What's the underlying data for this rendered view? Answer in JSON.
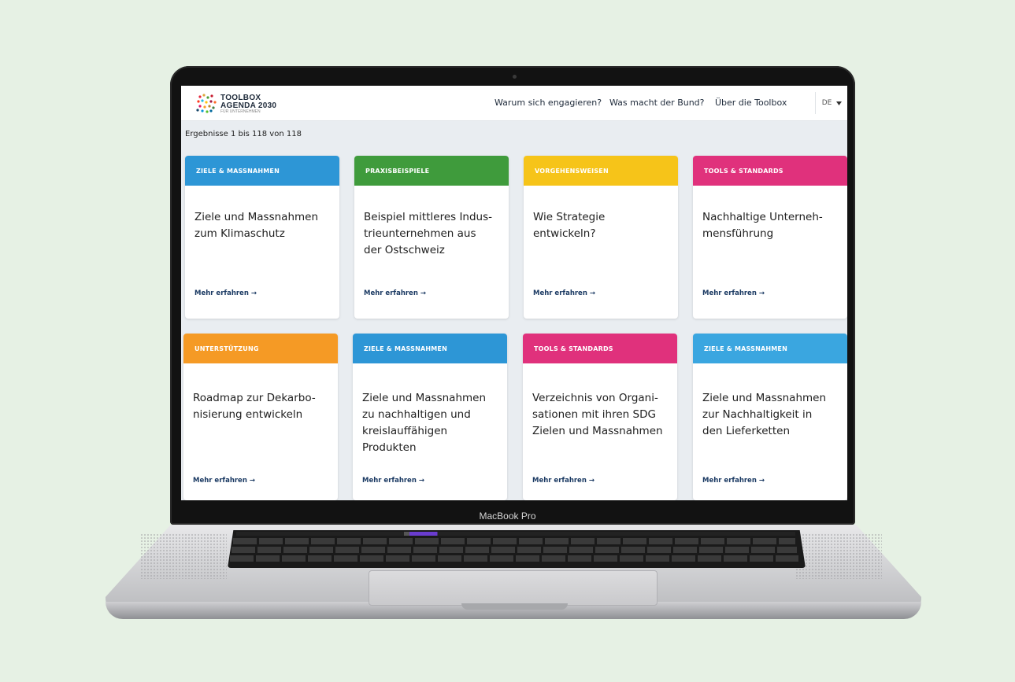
{
  "device": {
    "brand_label": "MacBook Pro"
  },
  "site": {
    "logo": {
      "line1": "TOOLBOX",
      "line2": "AGENDA 2030",
      "line3": "FÜR UNTERNEHMEN"
    },
    "nav": [
      {
        "label": "Warum sich engagieren?"
      },
      {
        "label": "Was macht der Bund?"
      },
      {
        "label": "Über die Toolbox"
      }
    ],
    "language": {
      "selected": "DE",
      "icon": "caret-down-icon"
    }
  },
  "results": {
    "text": "Ergebnisse 1 bis 118 von 118"
  },
  "cards": [
    {
      "category": "ZIELE & MASSNAHMEN",
      "color": "#2d96d6",
      "title": "Ziele und Massnahmen\nzum Klimaschutz",
      "link": "Mehr erfahren →"
    },
    {
      "category": "PRAXISBEISPIELE",
      "color": "#3f9b3c",
      "title": "Beispiel mittleres Indus-\ntrieunternehmen aus\nder Ostschweiz",
      "link": "Mehr erfahren →"
    },
    {
      "category": "VORGEHENSWEISEN",
      "color": "#f6c419",
      "title": "Wie Strategie\nentwickeln?",
      "link": "Mehr erfahren →"
    },
    {
      "category": "TOOLS & STANDARDS",
      "color": "#e0317c",
      "title": "Nachhaltige Unterneh-\nmensführung",
      "link": "Mehr erfahren →"
    },
    {
      "category": "UNTERSTÜTZUNG",
      "color": "#f59a25",
      "title": "Roadmap zur Dekarbo-\nnisierung entwickeln",
      "link": "Mehr erfahren →"
    },
    {
      "category": "ZIELE & MASSNAHMEN",
      "color": "#2d96d6",
      "title": "Ziele und Massnahmen\nzu nachhaltigen und\nkreislauffähigen\nProdukten",
      "link": "Mehr erfahren →"
    },
    {
      "category": "TOOLS & STANDARDS",
      "color": "#e0317c",
      "title": "Verzeichnis von Organi-\nsationen mit ihren SDG\nZielen und Massnahmen",
      "link": "Mehr erfahren →"
    },
    {
      "category": "ZIELE & MASSNAHMEN",
      "color": "#3aa6e0",
      "title": "Ziele und Massnahmen\nzur Nachhaltigkeit in\nden Lieferketten",
      "link": "Mehr erfahren →"
    }
  ]
}
